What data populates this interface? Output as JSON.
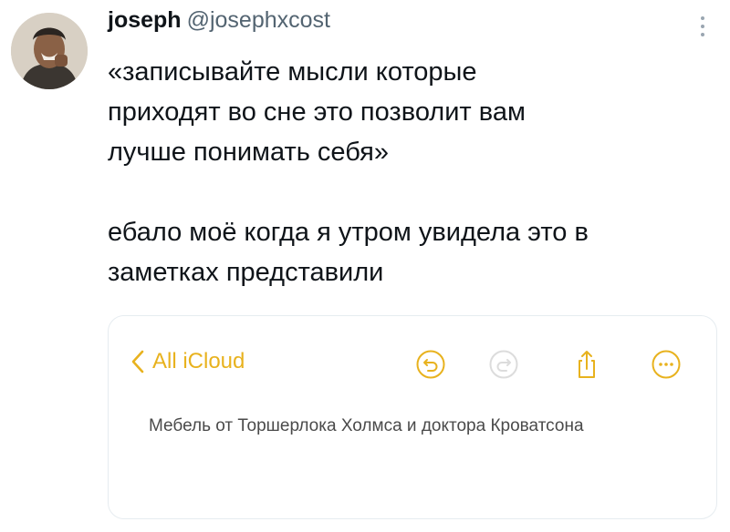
{
  "tweet": {
    "display_name": "joseph",
    "handle": "@josephxcost",
    "text_lines": [
      "«записывайте мысли которые",
      "приходят во сне это позволит вам",
      "лучше понимать себя»",
      "ебало моё когда я утром увидела это в",
      "заметках представили"
    ]
  },
  "note_card": {
    "back_label": "All iCloud",
    "note_text": "Мебель от Торшерлока Холмса и доктора Кроватсона",
    "accent_color": "#e8b21e",
    "toolbar_icons": [
      "undo-icon",
      "redo-icon",
      "share-icon",
      "more-circle-icon"
    ]
  }
}
